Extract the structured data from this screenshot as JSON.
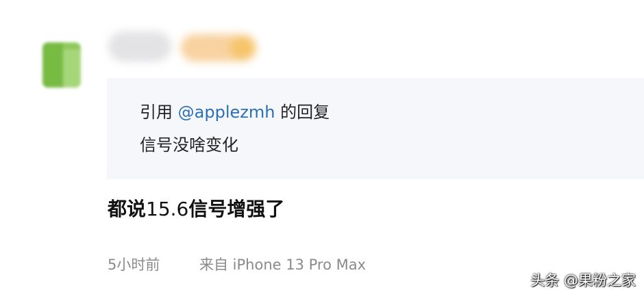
{
  "quote": {
    "prefix": "引用 ",
    "mention": "@applezmh",
    "suffix": " 的回复",
    "text": "信号没啥变化"
  },
  "post": {
    "text_part1": "都说",
    "text_number": "15.6",
    "text_part2": "信号增强了"
  },
  "meta": {
    "time": "5小时前",
    "source": "来自 iPhone 13 Pro Max"
  },
  "watermark": "头条 @果粉之家",
  "colors": {
    "mention": "#2b6fb8",
    "quote_background": "#f6f7fa",
    "meta_text": "#8a8a8a",
    "avatar_green": "#7cc24a"
  }
}
